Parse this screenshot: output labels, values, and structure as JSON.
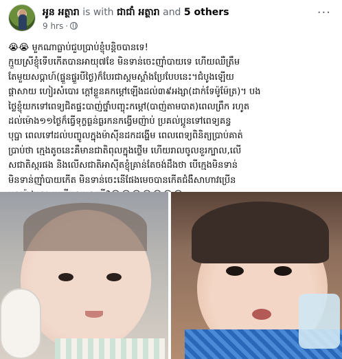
{
  "post": {
    "author_name": "អូន អត្ថារា",
    "with_text": "is with",
    "tagged_name": "ជាជាំ អត្ថារា",
    "and_text": "and",
    "others_text": "5 others",
    "time": "9 hrs",
    "privacy_icon": "globe-icon",
    "more_icon": "more-options-icon",
    "text_lines": [
      "😭😭 មួកណាធ្លាប់ជួបប្រាប់ខ្ញុំបន្តិចបានទេ!",
      "ក្មួយស្រីខ្ញុំទើបកើតបានអាយុ៧ខែ មិនទាន់ចេះញ៉ាំបាយទេ ហើយឈឺត្រឹម",
      "តែមួយសប្តាហ៍(ផ្ទួនផ្ទួរបីថ្ងៃ)ក៏បែរជាស្គមស្គាំងប្រែបែបនេះ។ជំបូងឡើយ",
      "ផ្តាសាយ ហៀរសំបោរ ក្តៅខ្លួនគកម្តៅឡើងដល់៣៩អង្សា(ដាក់ទែម៉ូម៉ែត្រ)។ បង",
      "ថ្លៃខ្ញុំយកទៅពេទ្យជិតផ្ទះបាញ់ថ្នាំបញ្ចុះកម្តៅ(បាញ់តាមបាត)ពេលព្រឹក រហូត",
      "ដល់ម៉ោង១១ថ្ងៃក៏ធ្វើទុក្ខធ្ងន់ធ្ងរកនកង្វើមញ៉ាប់ ប្រគល់ប្អូនទៅពេទ្យគន្ធ",
      "បុប្ផា ពេលទៅដល់បញ្ចូលក្នុងម៉ាស៊ីនដកដង្ហើម ពេលពេទ្យពិនិត្យប្រាប់គាត់",
      "ប្រាប់ថា ក្មេងតូចនេះគឺមានជាតិពុលក្នុងថ្លើម ហើយរាលចូលខួរក្បាល,លើ",
      "សជាតិស្ករផង និងលើសជាតិអាស៊ីតខ្ញុំគ្រាន់តែចង់ដឹងថា បើក្មេងមិនទាន់",
      "មិនទាន់ញ៉ាំបាយកើត មិនទាន់ចេះនើផែងមេចបានកើតជំងឺសាហាវប្រើន",
      "មុខយ៉ាងនេះ មកពីមូលហេតុអ្វី?😭😭😭😭😭😭😭"
    ],
    "photos": [
      {
        "name": "baby-photo-left",
        "alt": "photo"
      },
      {
        "name": "baby-photo-right",
        "alt": "photo"
      }
    ]
  },
  "colors": {
    "text": "#050505",
    "muted": "#606770",
    "background": "#ffffff"
  }
}
